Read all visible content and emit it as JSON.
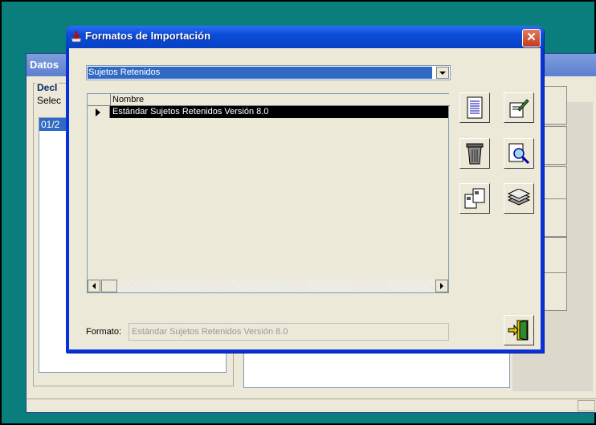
{
  "background_window": {
    "title": "Datos",
    "group_title": "Decl",
    "group_label": "Selec",
    "list_selected": "01/2"
  },
  "dialog": {
    "title": "Formatos de Importación",
    "close_glyph": "✕",
    "combo": {
      "selected": "Sujetos Retenidos"
    },
    "grid": {
      "columns": [
        "Nombre"
      ],
      "rows": [
        {
          "nombre": "Estándar Sujetos Retenidos Versión 8.0",
          "selected": true
        }
      ]
    },
    "formato": {
      "label": "Formato:",
      "value": "Estándar Sujetos Retenidos Versión 8.0"
    },
    "toolbar_icons": [
      "document-icon",
      "edit-icon",
      "trash-icon",
      "search-document-icon",
      "copy-icon",
      "stack-icon",
      "exit-icon"
    ]
  },
  "colors": {
    "desktop": "#0a7d7d",
    "titlebar": "#0a4cd8",
    "selection": "#316ac5",
    "close_button": "#c23b1f"
  }
}
